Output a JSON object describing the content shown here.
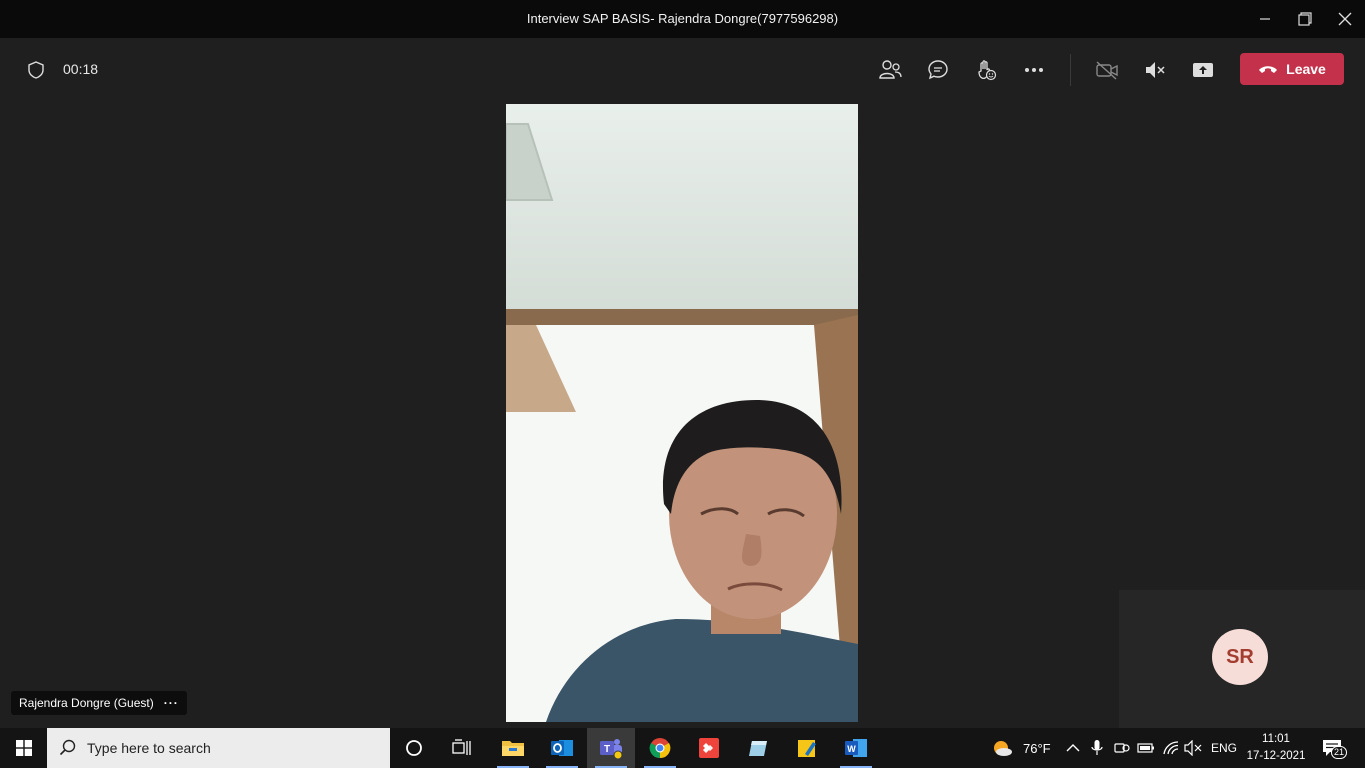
{
  "window": {
    "title": "Interview SAP BASIS- Rajendra Dongre(7977596298)"
  },
  "toolbar": {
    "timer": "00:18",
    "leave_label": "Leave",
    "icons": [
      "shield-icon",
      "participants-icon",
      "chat-icon",
      "raise-hand-icon",
      "more-icon",
      "camera-off-icon",
      "mic-muted-icon",
      "share-screen-icon",
      "phone-icon"
    ]
  },
  "participant": {
    "name": "Rajendra Dongre (Guest)",
    "more": "···"
  },
  "self_tile": {
    "initials": "SR"
  },
  "taskbar": {
    "search_placeholder": "Type here to search",
    "apps": [
      "cortana-icon",
      "task-view-icon",
      "file-explorer-icon",
      "outlook-icon",
      "teams-icon",
      "chrome-icon",
      "anydesk-icon",
      "app-icon",
      "sticky-app-icon",
      "word-icon"
    ],
    "weather": "76°F",
    "language": "ENG",
    "time": "11:01",
    "date": "17-12-2021",
    "notifications": "21"
  },
  "colors": {
    "leave": "#c4314b",
    "avatar_bg": "#f7ddd8",
    "avatar_text": "#a33d30",
    "teams": "#5b5fc7"
  }
}
